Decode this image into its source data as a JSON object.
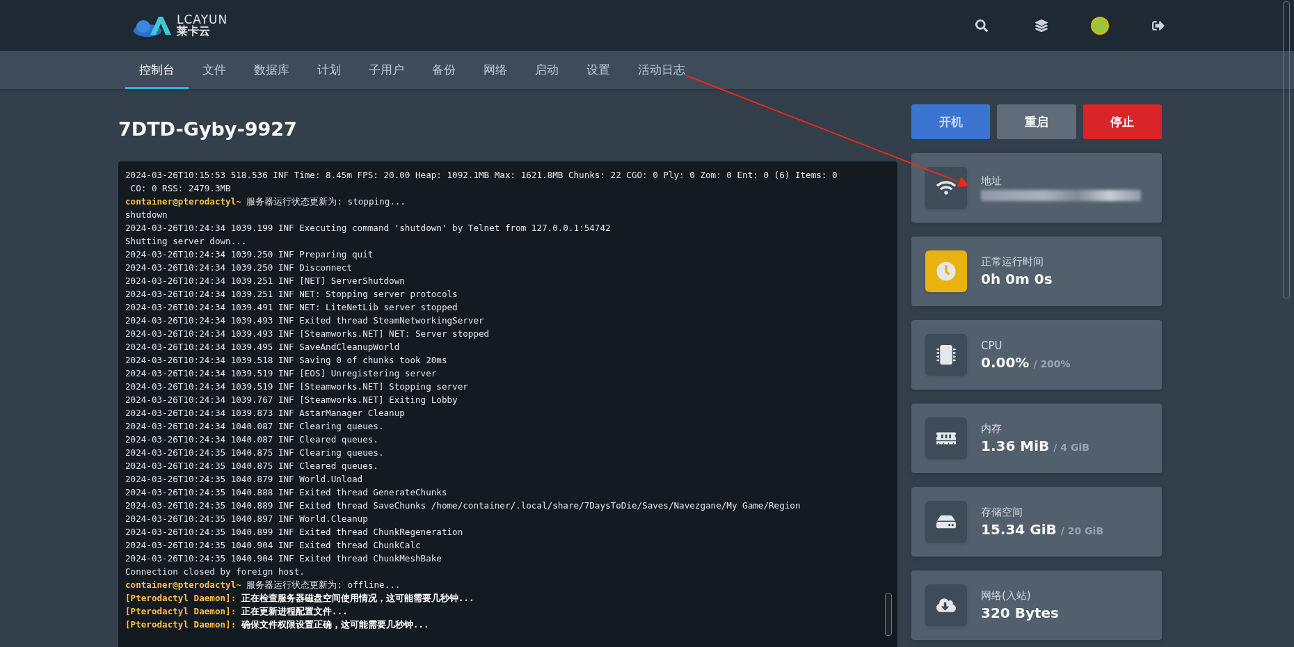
{
  "header": {
    "logo": {
      "wordmark": "LCAYUN",
      "name": "莱卡云"
    }
  },
  "nav": [
    {
      "label": "控制台",
      "selected": true
    },
    {
      "label": "文件",
      "selected": false
    },
    {
      "label": "数据库",
      "selected": false
    },
    {
      "label": "计划",
      "selected": false
    },
    {
      "label": "子用户",
      "selected": false
    },
    {
      "label": "备份",
      "selected": false
    },
    {
      "label": "网络",
      "selected": false
    },
    {
      "label": "启动",
      "selected": false
    },
    {
      "label": "设置",
      "selected": false
    },
    {
      "label": "活动日志",
      "selected": false
    }
  ],
  "server": {
    "name": "7DTD-Gyby-9927"
  },
  "power_buttons": [
    {
      "label": "开机",
      "kind": "start"
    },
    {
      "label": "重启",
      "kind": "restart"
    },
    {
      "label": "停止",
      "kind": "stop"
    }
  ],
  "console": [
    {
      "kind": "plain",
      "text": "2024-03-26T10:15:53 518.536 INF Time: 8.45m FPS: 20.00 Heap: 1092.1MB Max: 1621.8MB Chunks: 22 CGO: 0 Ply: 0 Zom: 0 Ent: 0 (6) Items: 0"
    },
    {
      "kind": "plain",
      "text": " CO: 0 RSS: 2479.3MB"
    },
    {
      "kind": "prompt",
      "prefix": "container@pterodactyl~",
      "text": "服务器运行状态更新为: stopping..."
    },
    {
      "kind": "plain",
      "text": "shutdown"
    },
    {
      "kind": "plain",
      "text": "2024-03-26T10:24:34 1039.199 INF Executing command 'shutdown' by Telnet from 127.0.0.1:54742"
    },
    {
      "kind": "plain",
      "text": "Shutting server down..."
    },
    {
      "kind": "plain",
      "text": "2024-03-26T10:24:34 1039.250 INF Preparing quit"
    },
    {
      "kind": "plain",
      "text": "2024-03-26T10:24:34 1039.250 INF Disconnect"
    },
    {
      "kind": "plain",
      "text": "2024-03-26T10:24:34 1039.251 INF [NET] ServerShutdown"
    },
    {
      "kind": "plain",
      "text": "2024-03-26T10:24:34 1039.251 INF NET: Stopping server protocols"
    },
    {
      "kind": "plain",
      "text": "2024-03-26T10:24:34 1039.491 INF NET: LiteNetLib server stopped"
    },
    {
      "kind": "plain",
      "text": "2024-03-26T10:24:34 1039.493 INF Exited thread SteamNetworkingServer"
    },
    {
      "kind": "plain",
      "text": "2024-03-26T10:24:34 1039.493 INF [Steamworks.NET] NET: Server stopped"
    },
    {
      "kind": "plain",
      "text": "2024-03-26T10:24:34 1039.495 INF SaveAndCleanupWorld"
    },
    {
      "kind": "plain",
      "text": "2024-03-26T10:24:34 1039.518 INF Saving 0 of chunks took 20ms"
    },
    {
      "kind": "plain",
      "text": "2024-03-26T10:24:34 1039.519 INF [EOS] Unregistering server"
    },
    {
      "kind": "plain",
      "text": "2024-03-26T10:24:34 1039.519 INF [Steamworks.NET] Stopping server"
    },
    {
      "kind": "plain",
      "text": "2024-03-26T10:24:34 1039.767 INF [Steamworks.NET] Exiting Lobby"
    },
    {
      "kind": "plain",
      "text": "2024-03-26T10:24:34 1039.873 INF AstarManager Cleanup"
    },
    {
      "kind": "plain",
      "text": "2024-03-26T10:24:34 1040.087 INF Clearing queues."
    },
    {
      "kind": "plain",
      "text": "2024-03-26T10:24:34 1040.087 INF Cleared queues."
    },
    {
      "kind": "plain",
      "text": "2024-03-26T10:24:35 1040.875 INF Clearing queues."
    },
    {
      "kind": "plain",
      "text": "2024-03-26T10:24:35 1040.875 INF Cleared queues."
    },
    {
      "kind": "plain",
      "text": "2024-03-26T10:24:35 1040.879 INF World.Unload"
    },
    {
      "kind": "plain",
      "text": "2024-03-26T10:24:35 1040.888 INF Exited thread GenerateChunks"
    },
    {
      "kind": "plain",
      "text": "2024-03-26T10:24:35 1040.889 INF Exited thread SaveChunks /home/container/.local/share/7DaysToDie/Saves/Navezgane/My Game/Region"
    },
    {
      "kind": "plain",
      "text": "2024-03-26T10:24:35 1040.897 INF World.Cleanup"
    },
    {
      "kind": "plain",
      "text": "2024-03-26T10:24:35 1040.899 INF Exited thread ChunkRegeneration"
    },
    {
      "kind": "plain",
      "text": "2024-03-26T10:24:35 1040.904 INF Exited thread ChunkCalc"
    },
    {
      "kind": "plain",
      "text": "2024-03-26T10:24:35 1040.904 INF Exited thread ChunkMeshBake"
    },
    {
      "kind": "plain",
      "text": "Connection closed by foreign host."
    },
    {
      "kind": "prompt",
      "prefix": "container@pterodactyl~",
      "text": "服务器运行状态更新为: offline..."
    },
    {
      "kind": "daemon",
      "prefix": "[Pterodactyl Daemon]:",
      "text": "正在检查服务器磁盘空间使用情况，这可能需要几秒钟..."
    },
    {
      "kind": "daemon",
      "prefix": "[Pterodactyl Daemon]:",
      "text": "正在更新进程配置文件..."
    },
    {
      "kind": "daemon",
      "prefix": "[Pterodactyl Daemon]:",
      "text": "确保文件权限设置正确，这可能需要几秒钟..."
    }
  ],
  "stats": [
    {
      "kind": "address",
      "label": "地址",
      "highlighted": false
    },
    {
      "kind": "uptime",
      "label": "正常运行时间",
      "value": "0h 0m 0s",
      "highlighted": true
    },
    {
      "kind": "cpu",
      "label": "CPU",
      "value": "0.00%",
      "limit": "/ 200%",
      "highlighted": false
    },
    {
      "kind": "memory",
      "label": "内存",
      "value": "1.36 MiB",
      "limit": "/ 4 GiB",
      "highlighted": false
    },
    {
      "kind": "disk",
      "label": "存储空间",
      "value": "15.34 GiB",
      "limit": "/ 20 GiB",
      "highlighted": false
    },
    {
      "kind": "network",
      "label": "网络(入站)",
      "value": "320 Bytes",
      "highlighted": false
    }
  ]
}
